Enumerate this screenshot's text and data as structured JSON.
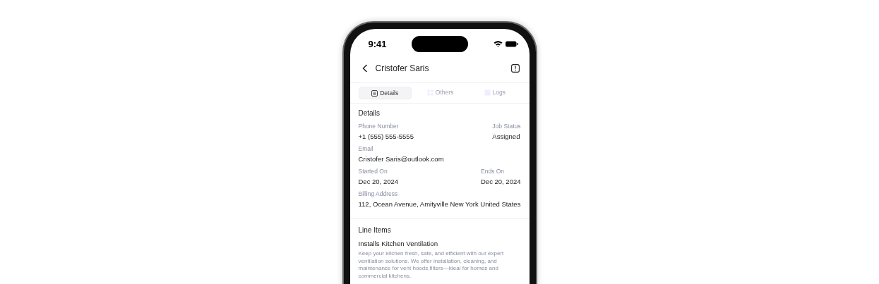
{
  "status_bar": {
    "time": "9:41"
  },
  "header": {
    "title": "Cristofer Saris"
  },
  "tabs": [
    {
      "label": "Details",
      "selected": true
    },
    {
      "label": "Others",
      "selected": false
    },
    {
      "label": "Logs",
      "selected": false
    }
  ],
  "details": {
    "title": "Details",
    "rows": [
      [
        {
          "label": "Phone Number",
          "value": "+1 (555) 555-5555"
        },
        {
          "label": "Job Status",
          "value": "Assigned"
        }
      ],
      [
        {
          "label": "Email",
          "value": "Cristofer Saris@outlook.com"
        }
      ],
      [
        {
          "label": "Started On",
          "value": "Dec 20, 2024"
        },
        {
          "label": "Ends On",
          "value": "Dec 20, 2024"
        }
      ],
      [
        {
          "label": "Billing Address",
          "value": "112, Ocean Avenue, Amityville New York United States"
        }
      ]
    ]
  },
  "line_items": {
    "title": "Line Items",
    "items": [
      {
        "name": "Installs Kitchen Ventilation",
        "description": "Keep your kitchen fresh, safe, and efficient with our expert ventilation solutions. We offer installation, cleaning, and maintenance for vent hoods,filters—ideal for homes and commercial kitchens."
      }
    ]
  }
}
